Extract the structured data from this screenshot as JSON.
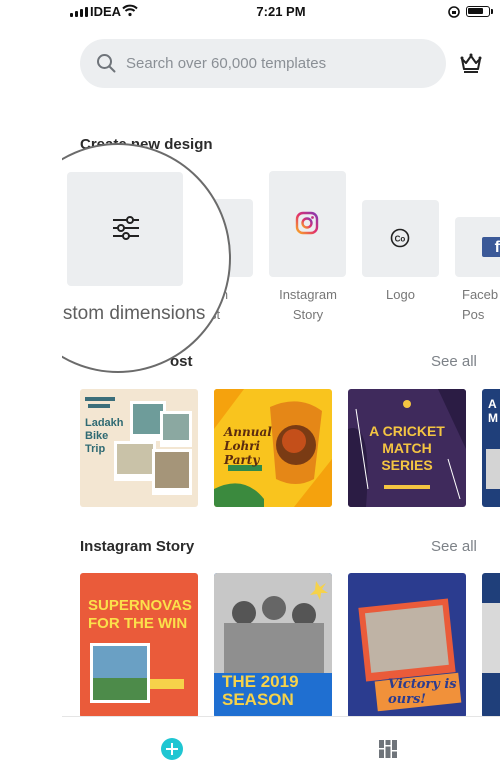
{
  "status_bar": {
    "carrier": "IDEA",
    "time": "7:21 PM",
    "battery_level": 0.85,
    "icons": [
      "signal-icon",
      "wifi-icon",
      "rotation-lock-icon",
      "battery-icon"
    ]
  },
  "search": {
    "placeholder": "Search over 60,000 templates"
  },
  "header": {
    "premium_icon": "crown-icon"
  },
  "create_section": {
    "title": "Create new design",
    "items": [
      {
        "label": "Custom dimensions",
        "icon": "sliders-icon"
      },
      {
        "label": "am\nst",
        "icon": ""
      },
      {
        "label": "Instagram Story",
        "icon": "instagram-icon"
      },
      {
        "label": "Logo",
        "icon": "copyright-icon"
      },
      {
        "label": "Faceb\nPos",
        "icon": "facebook-icon"
      }
    ]
  },
  "post_section": {
    "title": "ost",
    "see_all": "See all",
    "templates": [
      {
        "text": "Ladakh Bike Trip",
        "bg": "#f3e6d2"
      },
      {
        "text": "Annual Lohri Party",
        "bg": "#f9c41e"
      },
      {
        "text": "A CRICKET MATCH SERIES",
        "bg": "#3f2a5c"
      },
      {
        "text": "A M",
        "bg": "#1f3f7a"
      }
    ]
  },
  "story_section": {
    "title": "Instagram Story",
    "see_all": "See all",
    "templates": [
      {
        "text": "SUPERNOVAS FOR THE WIN",
        "bg": "#ea5b3a"
      },
      {
        "text": "THE 2019 SEASON",
        "bg": "#1f6fd1"
      },
      {
        "text": "Victory is ours!",
        "bg": "#2b3c8f"
      },
      {
        "text": "",
        "bg": "#1f3f7a"
      }
    ]
  },
  "bottom_nav": {
    "add_icon": "plus-circle-icon",
    "designs_icon": "grid-icon"
  },
  "colors": {
    "accent": "#1fc6d2",
    "tile_bg": "#eceef0",
    "muted_text": "#7d8288"
  }
}
